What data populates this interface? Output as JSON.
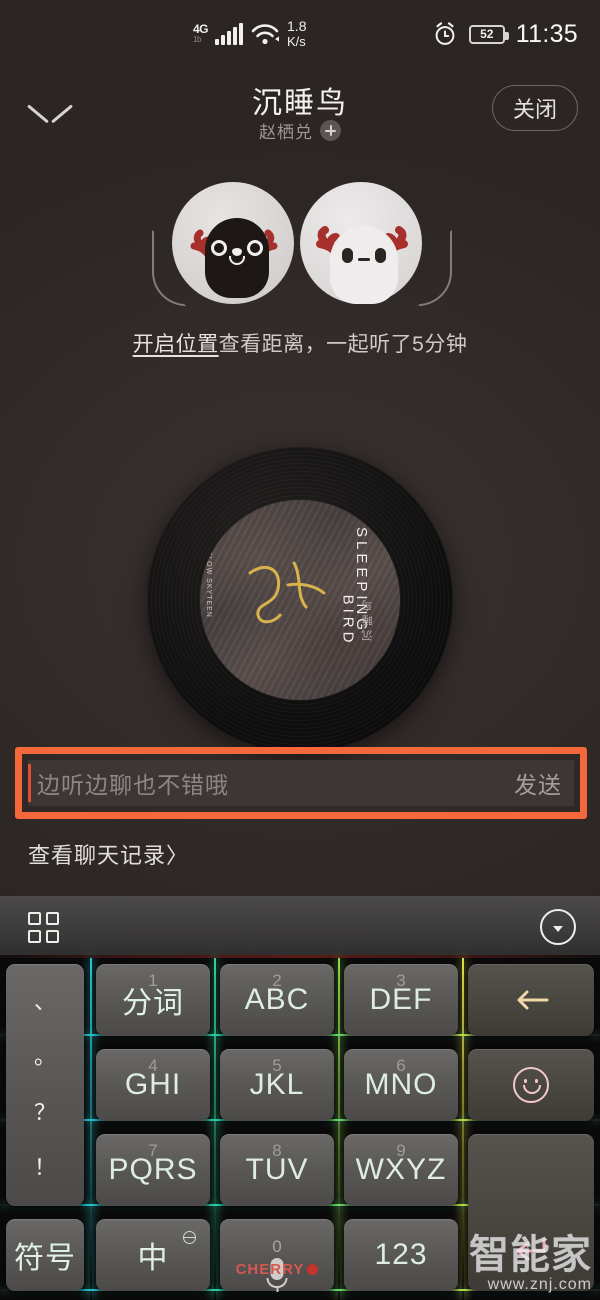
{
  "statusbar": {
    "network_type": "4G",
    "network_sub": "1b",
    "net_speed_value": "1.8",
    "net_speed_unit": "K/s",
    "battery_level": "52",
    "time": "11:35",
    "icons": {
      "signal": "signal-bars-icon",
      "wifi": "wifi-icon",
      "alarm": "alarm-clock-icon",
      "battery": "battery-icon"
    }
  },
  "header": {
    "collapse_icon": "chevron-down-icon",
    "title": "沉睡鸟",
    "subtitle": "赵栖兑",
    "follow_badge": "+",
    "close_label": "关闭"
  },
  "listen_together": {
    "avatar_left": "black-deer-avatar",
    "avatar_right": "white-deer-avatar",
    "link_text": "开启位置",
    "rest_text": "查看距离，一起听了5分钟"
  },
  "player": {
    "record_label_title_line1": "SLEEPING",
    "record_label_title_line2": "BIRD",
    "record_label_brand": "FLOW SKYTEEN",
    "record_label_cn": "沉睡鸟"
  },
  "input": {
    "placeholder": "边听边聊也不错哦",
    "value": "",
    "send_label": "发送",
    "highlight_color": "#f4683c",
    "caret_color": "#e24b35"
  },
  "chat_history": {
    "label": "查看聊天记录〉"
  },
  "keyboard": {
    "toolbar": {
      "grid_icon": "grid-apps-icon",
      "hide_icon": "chevron-down-circle-icon"
    },
    "punct_key": {
      "name": "punctuation-key",
      "marks": [
        "、",
        "。",
        "？",
        "！"
      ]
    },
    "rows": [
      [
        {
          "name": "key-1",
          "num": "1",
          "main": "分词",
          "style": "cn"
        },
        {
          "name": "key-2",
          "num": "2",
          "main": "ABC",
          "style": "alpha"
        },
        {
          "name": "key-3",
          "num": "3",
          "main": "DEF",
          "style": "alpha"
        }
      ],
      [
        {
          "name": "key-4",
          "num": "4",
          "main": "GHI",
          "style": "alpha"
        },
        {
          "name": "key-5",
          "num": "5",
          "main": "JKL",
          "style": "alpha"
        },
        {
          "name": "key-6",
          "num": "6",
          "main": "MNO",
          "style": "alpha"
        }
      ],
      [
        {
          "name": "key-7",
          "num": "7",
          "main": "PQRS",
          "style": "alpha"
        },
        {
          "name": "key-8",
          "num": "8",
          "main": "TUV",
          "style": "alpha"
        },
        {
          "name": "key-9",
          "num": "9",
          "main": "WXYZ",
          "style": "alpha"
        }
      ]
    ],
    "bottom_row": [
      {
        "name": "symbol-key",
        "main": "符号"
      },
      {
        "name": "language-key",
        "main": "中",
        "icon": "globe-icon"
      },
      {
        "name": "voice-key",
        "num": "0",
        "icon": "microphone-icon",
        "brand": "CHERRY"
      },
      {
        "name": "numeric-key",
        "main": "123"
      }
    ],
    "right_column": [
      {
        "name": "backspace-key",
        "icon": "backspace-icon"
      },
      {
        "name": "emoji-key",
        "icon": "smiley-face-icon"
      },
      {
        "name": "enter-key",
        "icon": "return-arrow-icon"
      }
    ]
  },
  "watermark": {
    "title": "智能家",
    "url": "www.znj.com"
  }
}
